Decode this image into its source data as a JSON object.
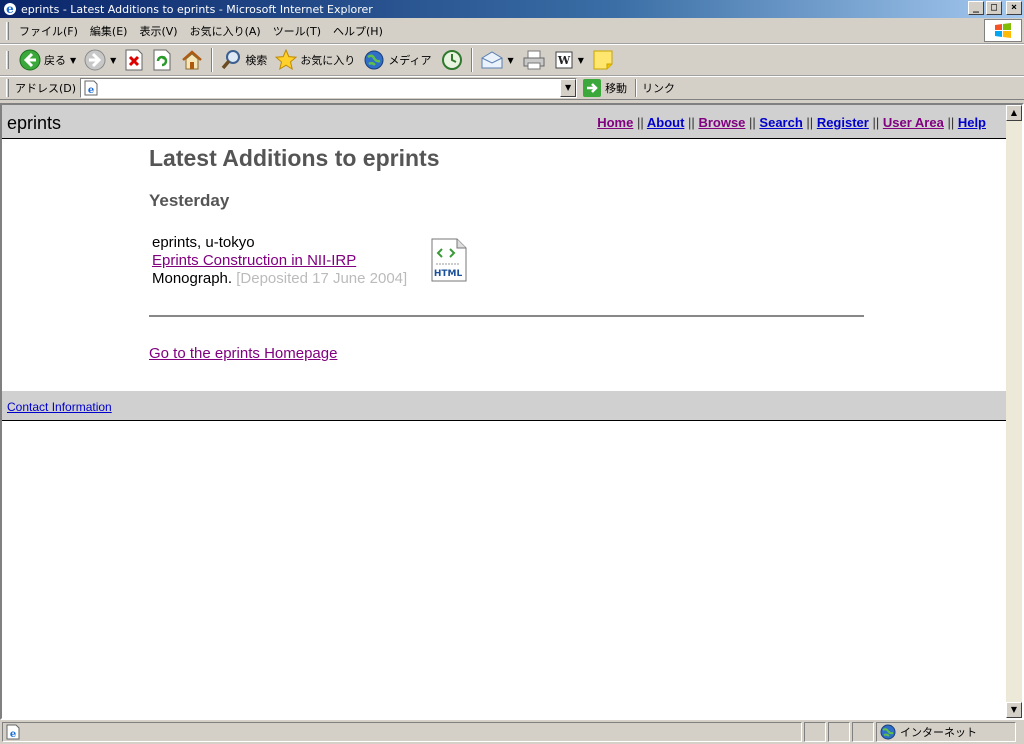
{
  "window": {
    "title": "eprints - Latest Additions to eprints - Microsoft Internet Explorer",
    "buttons": [
      "_",
      "□",
      "×"
    ]
  },
  "menubar": {
    "items": [
      "ファイル(F)",
      "編集(E)",
      "表示(V)",
      "お気に入り(A)",
      "ツール(T)",
      "ヘルプ(H)"
    ]
  },
  "toolbar": {
    "back_label": "戻る",
    "search_label": "検索",
    "favorites_label": "お気に入り",
    "media_label": "メディア"
  },
  "addressbar": {
    "label": "アドレス(D)",
    "value": "",
    "go_label": "移動",
    "links_label": "リンク"
  },
  "site": {
    "name": "eprints",
    "nav": [
      {
        "label": "Home",
        "visited": true
      },
      {
        "label": "About",
        "visited": false
      },
      {
        "label": "Browse",
        "visited": true
      },
      {
        "label": "Search",
        "visited": false
      },
      {
        "label": "Register",
        "visited": false
      },
      {
        "label": "User Area",
        "visited": true
      },
      {
        "label": "Help",
        "visited": false
      }
    ],
    "nav_separator": "||"
  },
  "main": {
    "title": "Latest Additions to eprints",
    "section": "Yesterday",
    "entry": {
      "authors": "eprints, u-tokyo",
      "title": "Eprints Construction in NII-IRP",
      "type": "Monograph.",
      "deposited": "[Deposited 17 June 2004]",
      "format_icon_text": "HTML"
    },
    "home_link": "Go to the eprints Homepage"
  },
  "footer": {
    "contact": "Contact Information"
  },
  "statusbar": {
    "status": "",
    "zone": "インターネット"
  }
}
